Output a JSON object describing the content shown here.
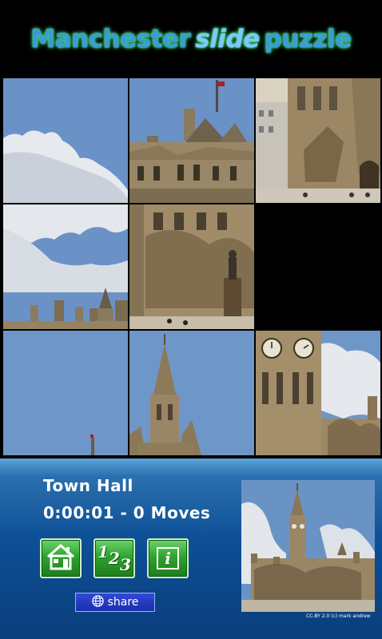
{
  "header": {
    "title_part1": "Manchester",
    "title_accent": "slide",
    "title_part2": "puzzle"
  },
  "puzzle": {
    "name": "Town Hall",
    "status": "0:00:01 - 0 Moves",
    "empty_slot": "row 2, column 3",
    "tiles": [
      "sky top-left",
      "town hall roofline",
      "town hall front right",
      "clouds",
      "town hall trees and statue",
      "empty",
      "sky bottom-left",
      "spire",
      "clock tower"
    ]
  },
  "controls": {
    "home_icon": "house-icon",
    "order_icon": "numbers-icon",
    "order_glyph_1": "1",
    "order_glyph_2": "2",
    "order_glyph_3": "3",
    "info_icon": "info-icon",
    "info_glyph": "i",
    "share_icon": "globe-icon",
    "share_label": "share"
  },
  "preview": {
    "credit": "CC-BY 2.0 (c) mark andrew"
  },
  "colors": {
    "title": "#3a9bd6",
    "title_glow": "#3fe37a",
    "panel": "#0d4f96",
    "button_green": "#2fa32f",
    "share_blue": "#1b2fa8",
    "sky": "#6a93c5"
  }
}
